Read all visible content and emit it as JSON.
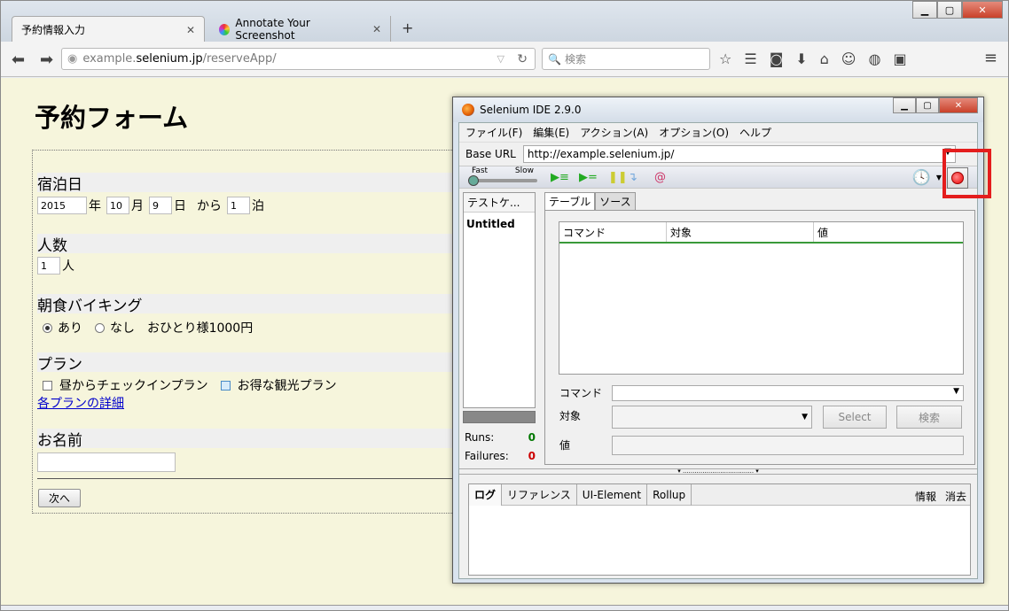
{
  "browser": {
    "tabs": [
      {
        "label": "予約情報入力",
        "active": true
      },
      {
        "label": "Annotate Your Screenshot",
        "active": false
      }
    ],
    "new_tab": "+",
    "url": {
      "prefix": "example.",
      "host": "selenium.jp",
      "path": "/reserveApp/"
    },
    "search_placeholder": "検索"
  },
  "page": {
    "title": "予約フォーム",
    "stay": {
      "label": "宿泊日",
      "year": "2015",
      "year_unit": "年",
      "month": "10",
      "month_unit": "月",
      "day": "9",
      "day_unit": "日",
      "from": "から",
      "nights": "1",
      "nights_unit": "泊"
    },
    "people": {
      "label": "人数",
      "value": "1",
      "unit": "人"
    },
    "breakfast": {
      "label": "朝食バイキング",
      "yes": "あり",
      "no": "なし",
      "note": "おひとり様1000円"
    },
    "plan": {
      "label": "プラン",
      "opt1": "昼からチェックインプラン",
      "opt2": "お得な観光プラン",
      "details_link": "各プランの詳細"
    },
    "name": {
      "label": "お名前",
      "value": ""
    },
    "submit": "次へ"
  },
  "selenium": {
    "title": "Selenium IDE 2.9.0",
    "menu": [
      "ファイル(F)",
      "編集(E)",
      "アクション(A)",
      "オプション(O)",
      "ヘルプ"
    ],
    "base_url_label": "Base URL",
    "base_url": "http://example.selenium.jp/",
    "speed_fast": "Fast",
    "speed_slow": "Slow",
    "testcase_header": "テストケ...",
    "testcase_item": "Untitled",
    "runs_label": "Runs:",
    "runs": "0",
    "failures_label": "Failures:",
    "failures": "0",
    "tab_table": "テーブル",
    "tab_source": "ソース",
    "columns": [
      "コマンド",
      "対象",
      "値"
    ],
    "command_label": "コマンド",
    "target_label": "対象",
    "value_label": "値",
    "select_btn": "Select",
    "find_btn": "検索",
    "log_tabs": [
      "ログ",
      "リファレンス",
      "UI-Element",
      "Rollup"
    ],
    "info": "情報",
    "clear": "消去"
  },
  "colors": {
    "highlight": "#e41d1d",
    "page_bg": "#f6f5dc"
  }
}
